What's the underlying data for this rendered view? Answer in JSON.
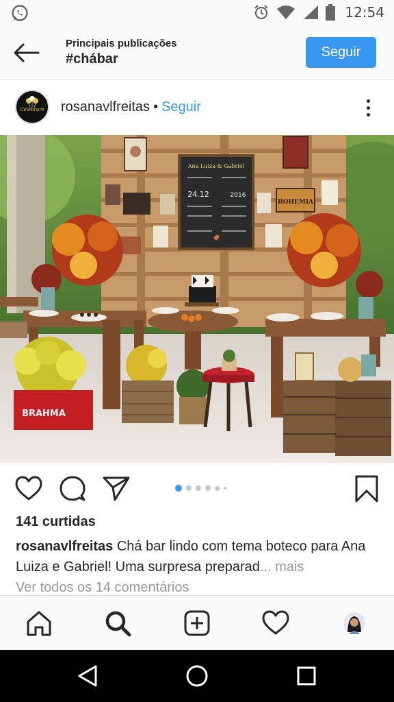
{
  "status_bar": {
    "time": "12:54",
    "icons": [
      "whatsapp-icon",
      "alarm-icon",
      "wifi-icon",
      "signal-icon",
      "battery-icon"
    ]
  },
  "header": {
    "subtitle": "Principais publicações",
    "title": "#chábar",
    "follow_label": "Seguir"
  },
  "post": {
    "username": "rosanavlfreitas",
    "separator": "•",
    "follow_label": "Seguir",
    "avatar_text": "Celebrare",
    "likes": "141 curtidas",
    "caption_user": "rosanavlfreitas",
    "caption_text": "Chá bar lindo com tema boteco para Ana Luiza e Gabriel! Uma surpresa preparad",
    "caption_more": "... mais",
    "comments_link": "Ver todos os 14 comentários",
    "photo_text": {
      "crate_brand": "BRAHMA",
      "sign_brand": "BOHEMIA",
      "board_title": "Ana Luiza & Gabriel",
      "board_date": "24.12",
      "board_year": "2016"
    },
    "carousel": {
      "count": 6,
      "active_index": 0
    }
  },
  "tabbar": {
    "items": [
      "home-icon",
      "search-icon",
      "add-post-icon",
      "activity-heart-icon",
      "profile-avatar"
    ]
  },
  "navbar": {
    "items": [
      "back-triangle-icon",
      "home-circle-icon",
      "recents-square-icon"
    ]
  },
  "colors": {
    "accent": "#3897f0",
    "text": "#262626",
    "muted": "#999999",
    "divider": "#dbdbdb"
  }
}
